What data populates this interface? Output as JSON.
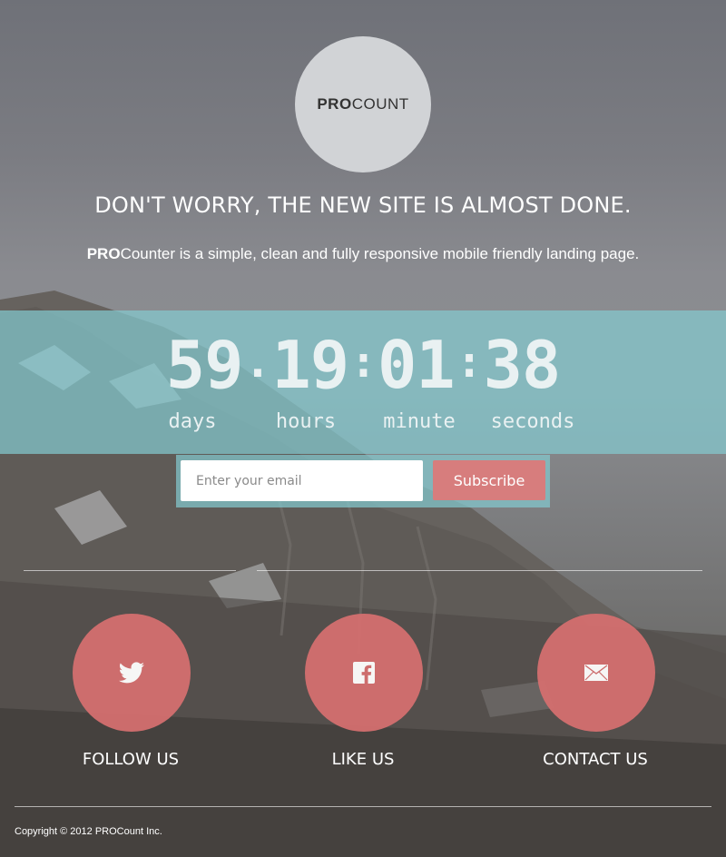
{
  "logo": {
    "bold": "PRO",
    "light": "COUNT"
  },
  "headline": "DON'T WORRY, THE NEW SITE IS ALMOST DONE.",
  "subline": {
    "bold": "PRO",
    "rest": "Counter is a simple, clean and fully responsive mobile friendly landing page."
  },
  "countdown": {
    "days": "59",
    "hours": "19",
    "minutes": "01",
    "seconds": "38",
    "sep1": ".",
    "sep2": ":",
    "sep3": ":",
    "labels": {
      "days": "days",
      "hours": "hours",
      "minutes": "minute",
      "seconds": "seconds"
    }
  },
  "subscribe": {
    "placeholder": "Enter your email",
    "button": "Subscribe"
  },
  "social": [
    {
      "label": "FOLLOW US",
      "icon": "twitter-icon"
    },
    {
      "label": "LIKE US",
      "icon": "facebook-icon"
    },
    {
      "label": "CONTACT US",
      "icon": "mail-icon"
    }
  ],
  "copyright": "Copyright © 2012 PROCount Inc.",
  "colors": {
    "accent": "#d46f6f",
    "band": "#83c9ce",
    "logo_bg": "#d1d3d6"
  }
}
